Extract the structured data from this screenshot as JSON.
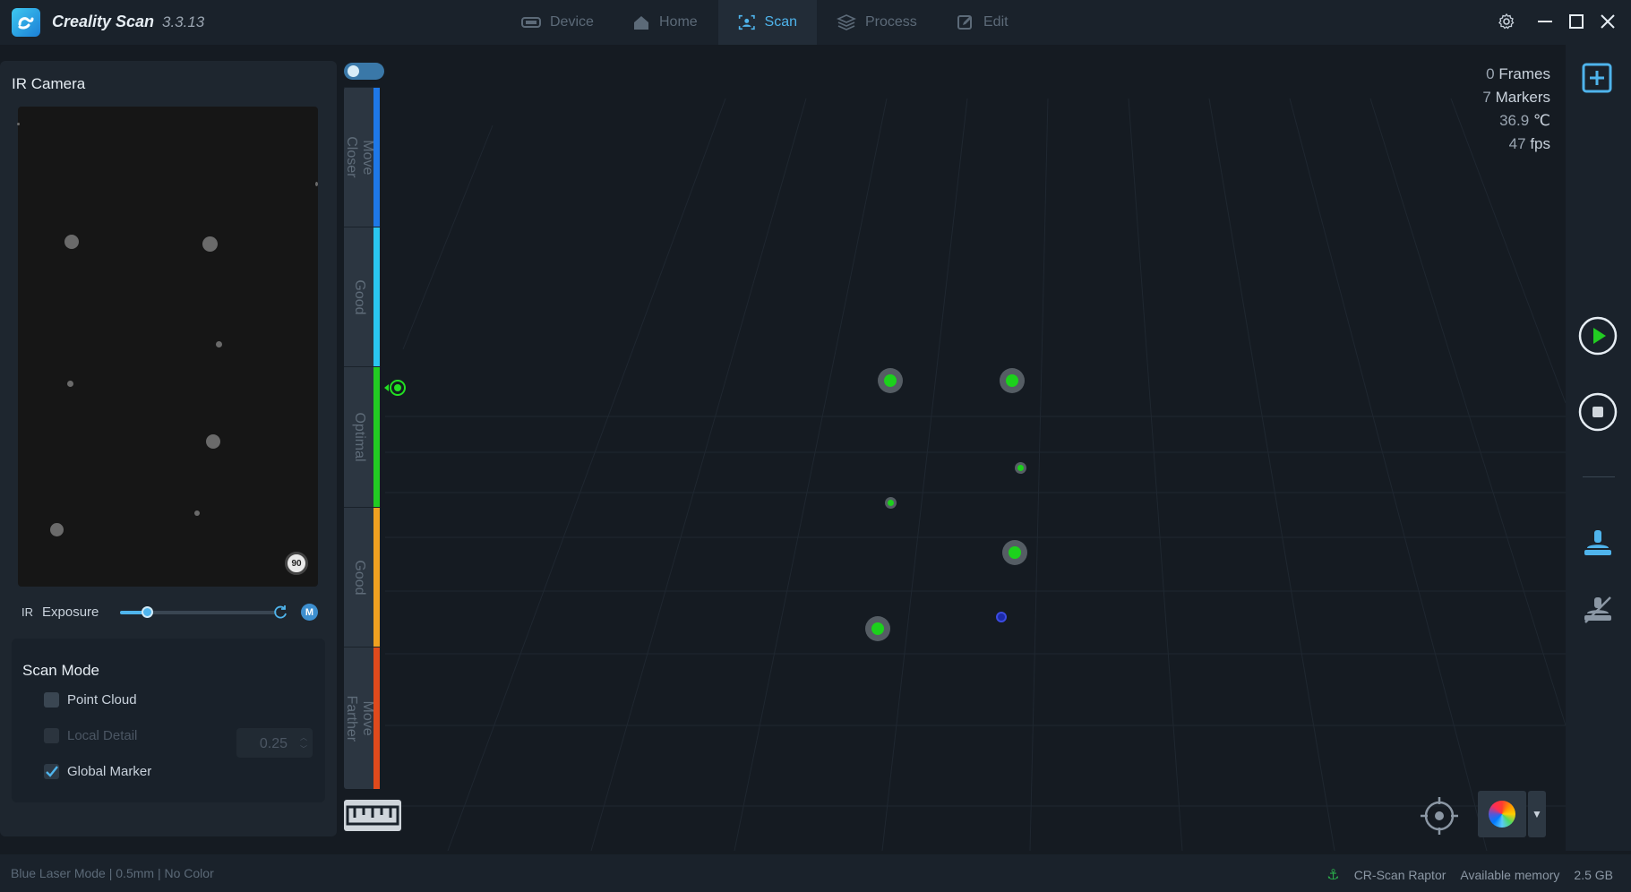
{
  "app": {
    "name": "Creality Scan",
    "version": "3.3.13"
  },
  "tabs": [
    {
      "label": "Device",
      "icon": "device-icon",
      "active": false
    },
    {
      "label": "Home",
      "icon": "home-icon",
      "active": false
    },
    {
      "label": "Scan",
      "icon": "scan-icon",
      "active": true
    },
    {
      "label": "Process",
      "icon": "process-icon",
      "active": false
    },
    {
      "label": "Edit",
      "icon": "edit-icon",
      "active": false
    }
  ],
  "window_controls": [
    "settings-icon",
    "minimize-icon",
    "maximize-icon",
    "close-icon"
  ],
  "ir_camera": {
    "title": "IR Camera",
    "rotate_label": "90",
    "exposure": {
      "prefix": "IR",
      "label": "Exposure",
      "level": 0.17,
      "mode_label": "M"
    }
  },
  "scan_mode": {
    "title": "Scan Mode",
    "options": [
      {
        "label": "Point Cloud",
        "checked": false,
        "enabled": true
      },
      {
        "label": "Local Detail",
        "checked": false,
        "enabled": false
      },
      {
        "label": "Global Marker",
        "checked": true,
        "enabled": true
      }
    ],
    "local_detail_value": "0.25"
  },
  "distance_bar": {
    "enabled": true,
    "segments": [
      {
        "label": "Move Closer",
        "color": "#1e78e8"
      },
      {
        "label": "Good",
        "color": "#2ac6f0"
      },
      {
        "label": "Optimal",
        "color": "#22cc22"
      },
      {
        "label": "Good",
        "color": "#f0a020"
      },
      {
        "label": "Move Farther",
        "color": "#e04a1c"
      }
    ],
    "indicator_color": "#22e022"
  },
  "stats": {
    "frames_value": "0",
    "frames_label": "Frames",
    "markers_value": "7",
    "markers_label": "Markers",
    "temperature_value": "36.9",
    "temperature_unit": "℃",
    "fps_value": "47",
    "fps_label": "fps"
  },
  "colors": {
    "accent": "#4fb4ec",
    "marker": "#1cd11c",
    "background": "#151b22"
  },
  "status_bar": {
    "mode": "Blue Laser Mode",
    "resolution": "0.5mm",
    "color_mode": "No Color",
    "device": "CR-Scan Raptor",
    "memory_label": "Available memory",
    "memory_value": "2.5 GB"
  }
}
